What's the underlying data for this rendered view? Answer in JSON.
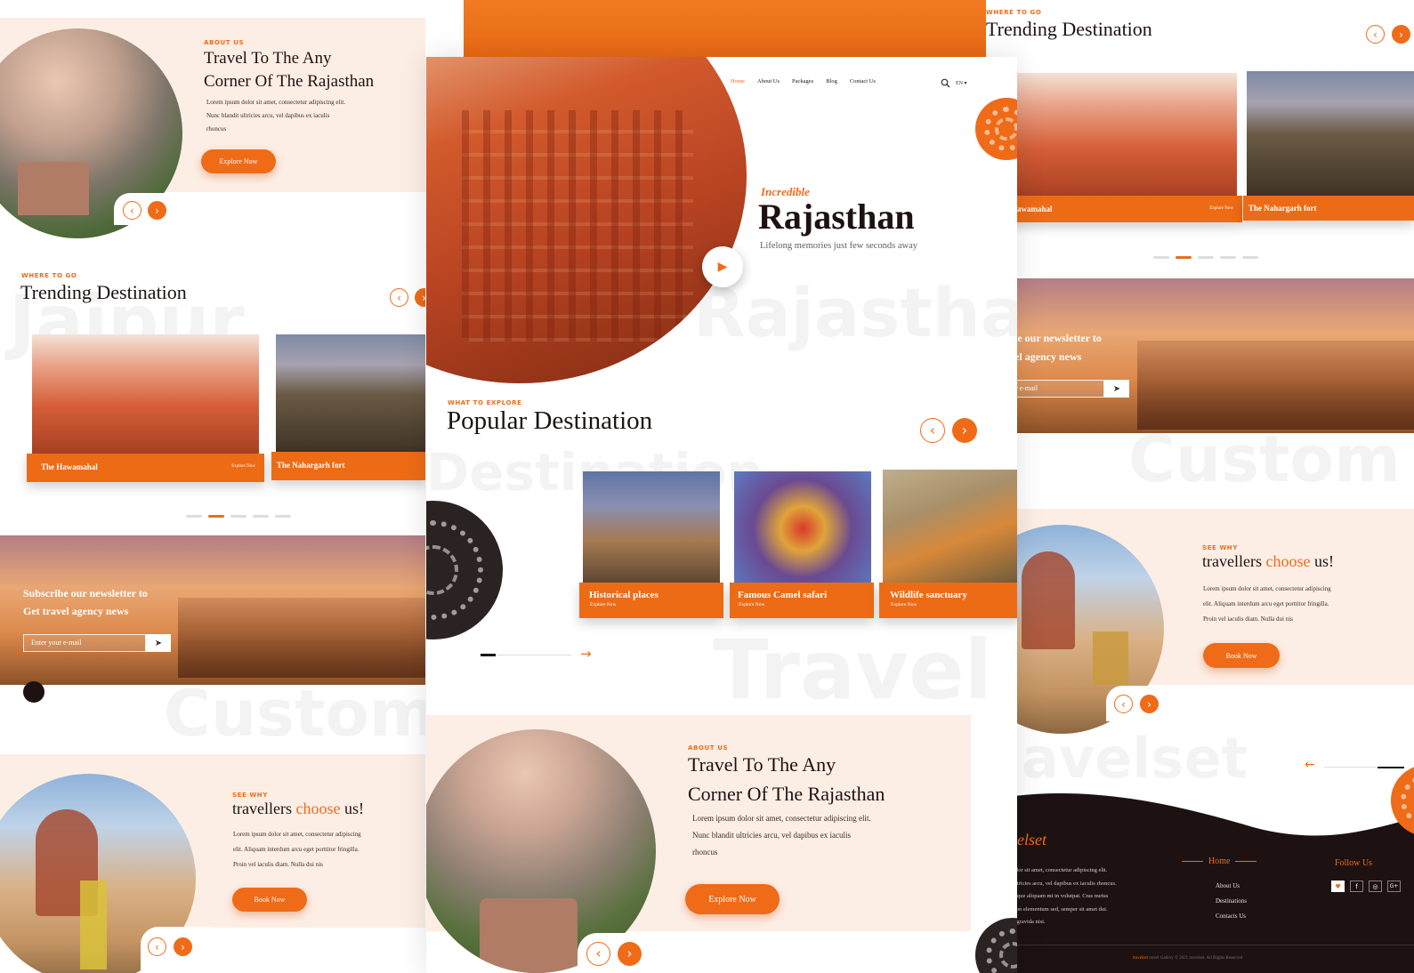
{
  "brand": {
    "accent": "#ef6b18",
    "dark": "#1d1211",
    "peach": "#fde8dd"
  },
  "left": {
    "about": {
      "tag": "About Us",
      "title_line1": "Travel To The Any",
      "title_line2": "Corner Of The Rajasthan",
      "text_line1": "Lorem ipsum dolor sit amet, consectetur adipiscing elit.",
      "text_line2": "Nunc blandit ultricies arcu, vel dapibus ex iaculis",
      "text_line3": "rhoncus",
      "button": "Explore Now",
      "prev_icon": "chevron-left-icon",
      "next_icon": "chevron-right-icon"
    },
    "trending": {
      "tag": "Where to go",
      "title": "Trending Destination",
      "bg_word": "Jaipur",
      "cards": [
        {
          "name": "The Hawamahal",
          "link": "Explore Now"
        },
        {
          "name": "The Nahargarh fort",
          "link": ""
        }
      ]
    },
    "newsletter": {
      "line1": "Subscribe our newsletter to",
      "line2": "Get travel agency news",
      "placeholder": "Enter your e-mail",
      "send_icon": "send-icon"
    },
    "why": {
      "tag": "See why",
      "title_a": "travellers ",
      "title_b": "choose",
      "title_c": " us!",
      "text_line1": "Lorem ipsum dolor sit amet, consectetur adipiscing",
      "text_line2": "elit. Aliquam interdum arcu eget porttitor fringilla.",
      "text_line3": "Proin vel iaculis diam. Nulla dui nis",
      "button": "Book Now",
      "bg_word": "Custom"
    }
  },
  "center": {
    "nav": {
      "items": [
        "Home",
        "About Us",
        "Packages",
        "Blog",
        "Contact Us"
      ],
      "lang": "EN ▾",
      "search_icon": "search-icon"
    },
    "hero": {
      "kicker": "Incredible",
      "title": "Rajasthan",
      "subtitle": "Lifelong memories just few seconds away",
      "bg_word": "Rajasthan",
      "play_icon": "play-icon"
    },
    "popular": {
      "tag": "What to explore",
      "title": "Popular Destination",
      "bg_word": "Destination",
      "cards": [
        {
          "name": "Historical places",
          "link": "Explore Now"
        },
        {
          "name": "Famous Camel safari",
          "link": "Explore Now"
        },
        {
          "name": "Wildlife sanctuary",
          "link": "Explore Now"
        }
      ],
      "arrow": "→"
    },
    "about": {
      "tag": "About Us",
      "title_line1": "Travel To The Any",
      "title_line2": "Corner Of The Rajasthan",
      "text_line1": "Lorem ipsum dolor sit amet, consectetur adipiscing elit.",
      "text_line2": "Nunc blandit ultricies arcu, vel dapibus ex iaculis",
      "text_line3": "rhoncus",
      "button": "Explore Now",
      "bg_word": "Travel"
    }
  },
  "right": {
    "trending": {
      "tag": "Where to go",
      "title": "Trending Destination",
      "cards": [
        {
          "name": "Hawamahal",
          "link": "Explore Now"
        },
        {
          "name": "The Nahargarh fort",
          "link": ""
        }
      ]
    },
    "newsletter": {
      "line1": "ribe our newsletter to",
      "line2": "avel agency news",
      "placeholder": "our e-mail"
    },
    "why": {
      "tag": "See why",
      "title_a": "travellers ",
      "title_b": "choose",
      "title_c": " us!",
      "text_line1": "Lorem ipsum dolor sit amet, consectetur adipiscing",
      "text_line2": "elit. Aliquam interdum arcu eget porttitor fringilla.",
      "text_line3": "Proin vel iaculis diam. Nulla dui nis",
      "button": "Book Now",
      "bg_word": "Custom"
    },
    "footer": {
      "brand": "avelset",
      "bg_word": "avelset",
      "text_lines": [
        "um dolor sit amet, consectetur adipiscing elit.",
        "ndit ultricies arcu, vel dapibus ex iaculis rhoncus.",
        "llentesque aliquam mi in volutpat. Cras metus",
        "ibus non elementum sed, semper sit amet dui.",
        "ictum gravida nisi."
      ],
      "links_title": "Home",
      "links": [
        "About Us",
        "Destinations",
        "Contacts Us"
      ],
      "follow_title": "Follow Us",
      "social": [
        "♥",
        "f",
        "◎",
        "G+"
      ],
      "copyright_brand": "travelset",
      "copyright": " travel Gallery © 2021 travelset. All Rights Reserved",
      "arrow": "←"
    }
  }
}
